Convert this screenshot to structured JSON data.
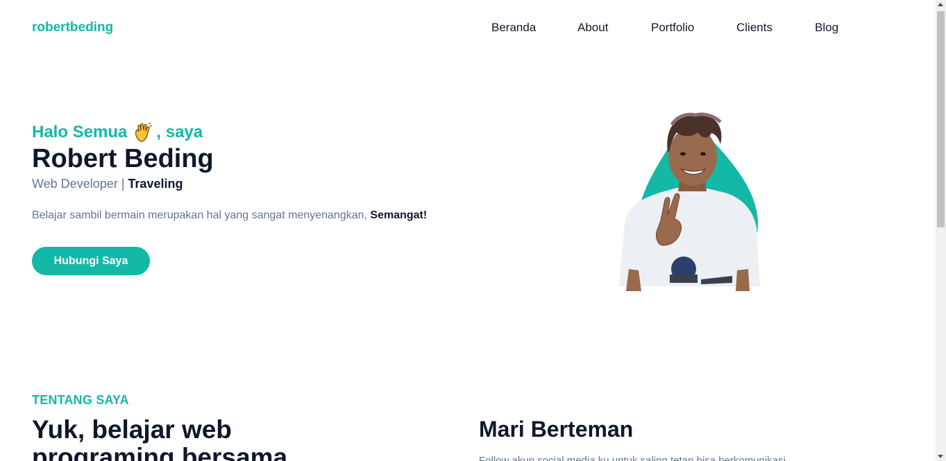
{
  "header": {
    "logo": "robertbeding",
    "nav": [
      "Beranda",
      "About",
      "Portfolio",
      "Clients",
      "Blog"
    ]
  },
  "hero": {
    "greeting_prefix": "Halo Semua",
    "greeting_suffix": ", saya",
    "wave_icon": "waving-hand-icon",
    "name": "Robert Beding",
    "role_prefix": "Web Developer | ",
    "role_strong": "Traveling",
    "description": "Belajar sambil bermain merupakan hal yang sangat menyenangkan, ",
    "description_strong": "Semangat!",
    "cta_label": "Hubungi Saya"
  },
  "about": {
    "kicker": "TENTANG SAYA",
    "title": "Yuk, belajar web programing bersama",
    "friends_title": "Mari Berteman",
    "friends_text": "Follow akun social media ku untuk saling tetap bisa berkomunikasi"
  },
  "colors": {
    "accent": "#14b8a6",
    "dark": "#0f172a",
    "muted": "#64748b"
  }
}
